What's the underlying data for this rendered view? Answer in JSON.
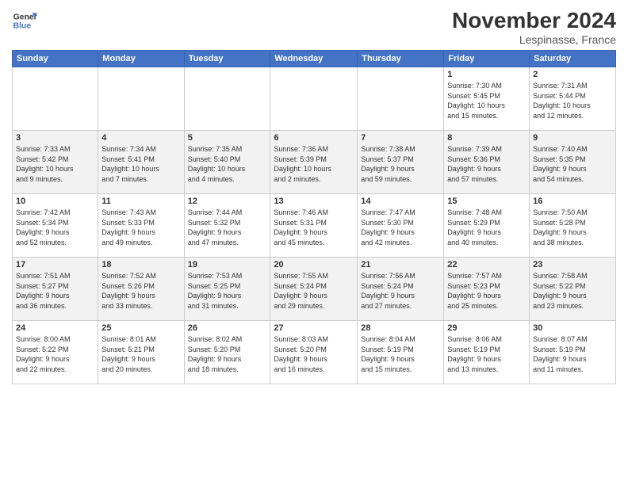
{
  "app": {
    "name_general": "General",
    "name_blue": "Blue"
  },
  "header": {
    "month_title": "November 2024",
    "location": "Lespinasse, France"
  },
  "calendar": {
    "weekdays": [
      "Sunday",
      "Monday",
      "Tuesday",
      "Wednesday",
      "Thursday",
      "Friday",
      "Saturday"
    ],
    "weeks": [
      [
        {
          "day": "",
          "info": ""
        },
        {
          "day": "",
          "info": ""
        },
        {
          "day": "",
          "info": ""
        },
        {
          "day": "",
          "info": ""
        },
        {
          "day": "",
          "info": ""
        },
        {
          "day": "1",
          "info": "Sunrise: 7:30 AM\nSunset: 5:45 PM\nDaylight: 10 hours\nand 15 minutes."
        },
        {
          "day": "2",
          "info": "Sunrise: 7:31 AM\nSunset: 5:44 PM\nDaylight: 10 hours\nand 12 minutes."
        }
      ],
      [
        {
          "day": "3",
          "info": "Sunrise: 7:33 AM\nSunset: 5:42 PM\nDaylight: 10 hours\nand 9 minutes."
        },
        {
          "day": "4",
          "info": "Sunrise: 7:34 AM\nSunset: 5:41 PM\nDaylight: 10 hours\nand 7 minutes."
        },
        {
          "day": "5",
          "info": "Sunrise: 7:35 AM\nSunset: 5:40 PM\nDaylight: 10 hours\nand 4 minutes."
        },
        {
          "day": "6",
          "info": "Sunrise: 7:36 AM\nSunset: 5:39 PM\nDaylight: 10 hours\nand 2 minutes."
        },
        {
          "day": "7",
          "info": "Sunrise: 7:38 AM\nSunset: 5:37 PM\nDaylight: 9 hours\nand 59 minutes."
        },
        {
          "day": "8",
          "info": "Sunrise: 7:39 AM\nSunset: 5:36 PM\nDaylight: 9 hours\nand 57 minutes."
        },
        {
          "day": "9",
          "info": "Sunrise: 7:40 AM\nSunset: 5:35 PM\nDaylight: 9 hours\nand 54 minutes."
        }
      ],
      [
        {
          "day": "10",
          "info": "Sunrise: 7:42 AM\nSunset: 5:34 PM\nDaylight: 9 hours\nand 52 minutes."
        },
        {
          "day": "11",
          "info": "Sunrise: 7:43 AM\nSunset: 5:33 PM\nDaylight: 9 hours\nand 49 minutes."
        },
        {
          "day": "12",
          "info": "Sunrise: 7:44 AM\nSunset: 5:32 PM\nDaylight: 9 hours\nand 47 minutes."
        },
        {
          "day": "13",
          "info": "Sunrise: 7:46 AM\nSunset: 5:31 PM\nDaylight: 9 hours\nand 45 minutes."
        },
        {
          "day": "14",
          "info": "Sunrise: 7:47 AM\nSunset: 5:30 PM\nDaylight: 9 hours\nand 42 minutes."
        },
        {
          "day": "15",
          "info": "Sunrise: 7:48 AM\nSunset: 5:29 PM\nDaylight: 9 hours\nand 40 minutes."
        },
        {
          "day": "16",
          "info": "Sunrise: 7:50 AM\nSunset: 5:28 PM\nDaylight: 9 hours\nand 38 minutes."
        }
      ],
      [
        {
          "day": "17",
          "info": "Sunrise: 7:51 AM\nSunset: 5:27 PM\nDaylight: 9 hours\nand 36 minutes."
        },
        {
          "day": "18",
          "info": "Sunrise: 7:52 AM\nSunset: 5:26 PM\nDaylight: 9 hours\nand 33 minutes."
        },
        {
          "day": "19",
          "info": "Sunrise: 7:53 AM\nSunset: 5:25 PM\nDaylight: 9 hours\nand 31 minutes."
        },
        {
          "day": "20",
          "info": "Sunrise: 7:55 AM\nSunset: 5:24 PM\nDaylight: 9 hours\nand 29 minutes."
        },
        {
          "day": "21",
          "info": "Sunrise: 7:56 AM\nSunset: 5:24 PM\nDaylight: 9 hours\nand 27 minutes."
        },
        {
          "day": "22",
          "info": "Sunrise: 7:57 AM\nSunset: 5:23 PM\nDaylight: 9 hours\nand 25 minutes."
        },
        {
          "day": "23",
          "info": "Sunrise: 7:58 AM\nSunset: 5:22 PM\nDaylight: 9 hours\nand 23 minutes."
        }
      ],
      [
        {
          "day": "24",
          "info": "Sunrise: 8:00 AM\nSunset: 5:22 PM\nDaylight: 9 hours\nand 22 minutes."
        },
        {
          "day": "25",
          "info": "Sunrise: 8:01 AM\nSunset: 5:21 PM\nDaylight: 9 hours\nand 20 minutes."
        },
        {
          "day": "26",
          "info": "Sunrise: 8:02 AM\nSunset: 5:20 PM\nDaylight: 9 hours\nand 18 minutes."
        },
        {
          "day": "27",
          "info": "Sunrise: 8:03 AM\nSunset: 5:20 PM\nDaylight: 9 hours\nand 16 minutes."
        },
        {
          "day": "28",
          "info": "Sunrise: 8:04 AM\nSunset: 5:19 PM\nDaylight: 9 hours\nand 15 minutes."
        },
        {
          "day": "29",
          "info": "Sunrise: 8:06 AM\nSunset: 5:19 PM\nDaylight: 9 hours\nand 13 minutes."
        },
        {
          "day": "30",
          "info": "Sunrise: 8:07 AM\nSunset: 5:19 PM\nDaylight: 9 hours\nand 11 minutes."
        }
      ]
    ]
  }
}
